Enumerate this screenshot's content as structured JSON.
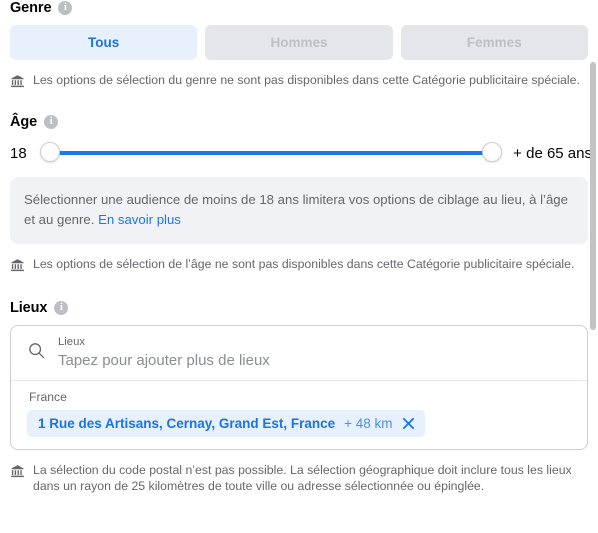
{
  "gender": {
    "title": "Genre",
    "info_icon": "info-icon",
    "options": [
      {
        "label": "Tous",
        "selected": true
      },
      {
        "label": "Hommes",
        "selected": false
      },
      {
        "label": "Femmes",
        "selected": false
      }
    ],
    "disclaimer": "Les options de sélection du genre ne sont pas disponibles dans cette Catégorie publicitaire spéciale.",
    "disclaimer_icon": "bank-icon"
  },
  "age": {
    "title": "Âge",
    "info_icon": "info-icon",
    "min_label": "18",
    "max_label": "+ de 65 ans",
    "slider": {
      "left_knob": "slider-handle-min",
      "right_knob": "slider-handle-max",
      "track_color": "#1877f2"
    },
    "notice_text": "Sélectionner une audience de moins de 18 ans limitera vos options de ciblage au lieu, à l’âge et au genre. ",
    "notice_link": "En savoir plus",
    "disclaimer": "Les options de sélection de l’âge ne sont pas disponibles dans cette Catégorie publicitaire spéciale.",
    "disclaimer_icon": "bank-icon"
  },
  "places": {
    "title": "Lieux",
    "info_icon": "info-icon",
    "search": {
      "icon": "search-icon",
      "label": "Lieux",
      "placeholder": "Tapez pour ajouter plus de lieux",
      "value": ""
    },
    "region_label": "France",
    "chips": [
      {
        "name": "1 Rue des Artisans, Cernay, Grand Est, France",
        "radius": "+ 48 km",
        "remove_icon": "close-icon"
      }
    ],
    "disclaimer": "La sélection du code postal n’est pas possible. La sélection géographique doit inclure tous les lieux dans un rayon de 25 kilomètres de toute ville ou adresse sélectionnée ou épinglée.",
    "disclaimer_icon": "bank-icon"
  },
  "colors": {
    "accent_blue": "#1877f2",
    "link_blue": "#1b74e4",
    "selected_chip_bg": "#e7f0fd",
    "muted_gray": "#65676b",
    "disabled_bg": "#e4e6eb"
  }
}
